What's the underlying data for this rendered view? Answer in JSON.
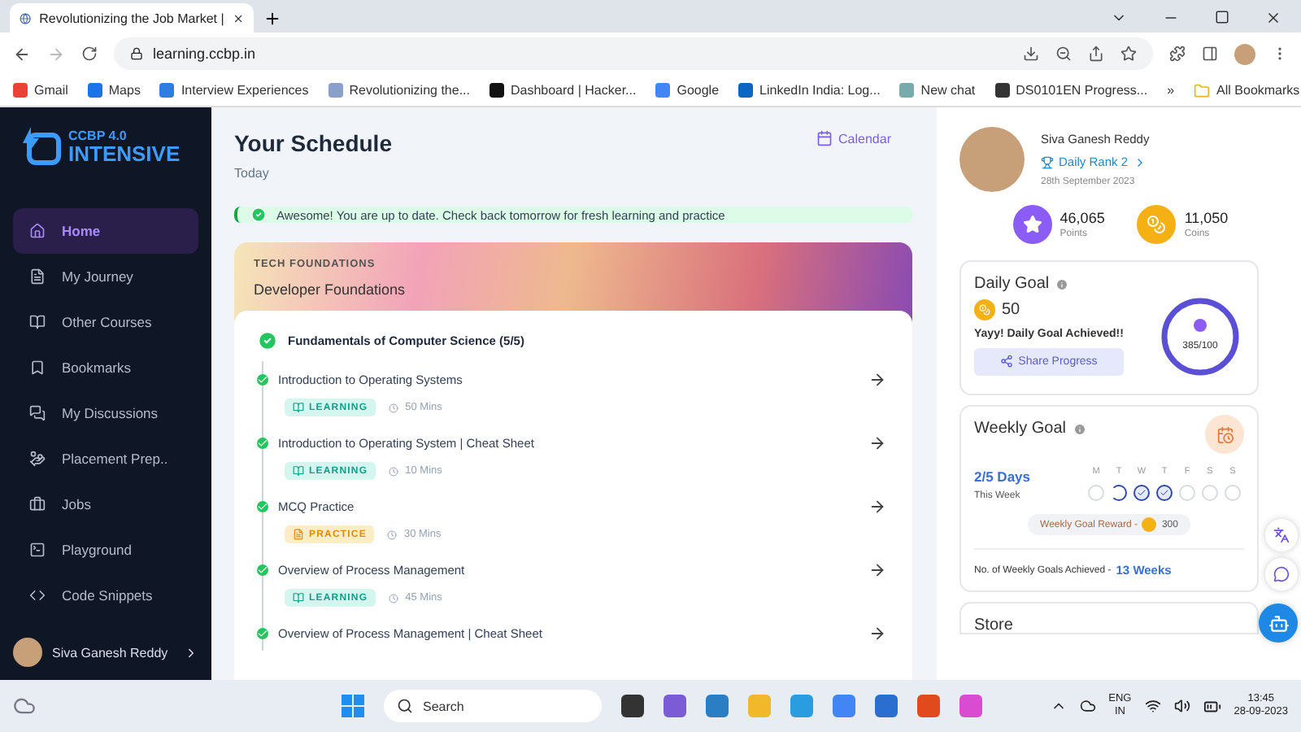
{
  "browser": {
    "tab_title": "Revolutionizing the Job Market |",
    "address": "learning.ccbp.in",
    "bookmarks": [
      "Gmail",
      "Maps",
      "Interview Experiences",
      "Revolutionizing the...",
      "Dashboard | Hacker...",
      "Google",
      "LinkedIn India: Log...",
      "New chat",
      "DS0101EN Progress..."
    ],
    "overflow": "»",
    "all_bookmarks": "All Bookmarks"
  },
  "sidebar": {
    "logo_top": "CCBP 4.0",
    "logo_bottom": "INTENSIVE",
    "items": [
      {
        "label": "Home",
        "selected": true
      },
      {
        "label": "My Journey",
        "selected": false
      },
      {
        "label": "Other Courses",
        "selected": false
      },
      {
        "label": "Bookmarks",
        "selected": false
      },
      {
        "label": "My Discussions",
        "selected": false
      },
      {
        "label": "Placement Prep..",
        "selected": false
      },
      {
        "label": "Jobs",
        "selected": false
      },
      {
        "label": "Playground",
        "selected": false
      },
      {
        "label": "Code Snippets",
        "selected": false
      }
    ],
    "user": "Siva Ganesh Reddy"
  },
  "schedule": {
    "title": "Your Schedule",
    "subtitle": "Today",
    "calendar": "Calendar",
    "alert": "Awesome! You are up to date. Check back tomorrow for fresh learning and practice",
    "card": {
      "category": "TECH FOUNDATIONS",
      "title": "Developer Foundations",
      "module": {
        "title": "Fundamentals of Computer Science (5/5)",
        "completed": true
      },
      "lessons": [
        {
          "title": "Introduction to Operating Systems",
          "completed": true,
          "tag": {
            "kind": "learning",
            "label": "LEARNING"
          },
          "duration": "50 Mins"
        },
        {
          "title": "Introduction to Operating System | Cheat Sheet",
          "completed": true,
          "tag": {
            "kind": "learning",
            "label": "LEARNING"
          },
          "duration": "10 Mins"
        },
        {
          "title": "MCQ Practice",
          "completed": true,
          "tag": {
            "kind": "practice",
            "label": "PRACTICE"
          },
          "duration": "30 Mins"
        },
        {
          "title": "Overview of Process Management",
          "completed": true,
          "tag": {
            "kind": "learning",
            "label": "LEARNING"
          },
          "duration": "45 Mins"
        },
        {
          "title": "Overview of Process Management | Cheat Sheet",
          "completed": true
        }
      ]
    }
  },
  "profile": {
    "name": "Siva Ganesh Reddy",
    "rank": "Daily Rank 2",
    "date": "28th September 2023",
    "points": {
      "value": "46,065",
      "label": "Points"
    },
    "coins": {
      "value": "11,050",
      "label": "Coins"
    }
  },
  "daily_goal": {
    "title": "Daily Goal",
    "coins": "50",
    "message": "Yayy! Daily Goal Achieved!!",
    "share": "Share Progress",
    "ring": {
      "reading": "385/100",
      "level": 1
    }
  },
  "weekly_goal": {
    "title": "Weekly Goal",
    "days": "2/5 Days",
    "period": "This Week",
    "week": [
      {
        "label": "M",
        "checked": false,
        "partial": false
      },
      {
        "label": "T",
        "checked": false,
        "partial": true
      },
      {
        "label": "W",
        "checked": true,
        "partial": false
      },
      {
        "label": "T",
        "checked": true,
        "partial": false
      },
      {
        "label": "F",
        "checked": false,
        "partial": false
      },
      {
        "label": "S",
        "checked": false,
        "partial": false
      },
      {
        "label": "S",
        "checked": false,
        "partial": false
      }
    ],
    "reward_label": "Weekly Goal Reward -",
    "reward": "300",
    "achieved_label": "No. of Weekly Goals Achieved -",
    "achieved": "13 Weeks"
  },
  "store": {
    "title": "Store"
  },
  "taskbar": {
    "search": "Search",
    "lang": "ENG",
    "region": "IN",
    "time": "13:45",
    "date": "28-09-2023"
  }
}
